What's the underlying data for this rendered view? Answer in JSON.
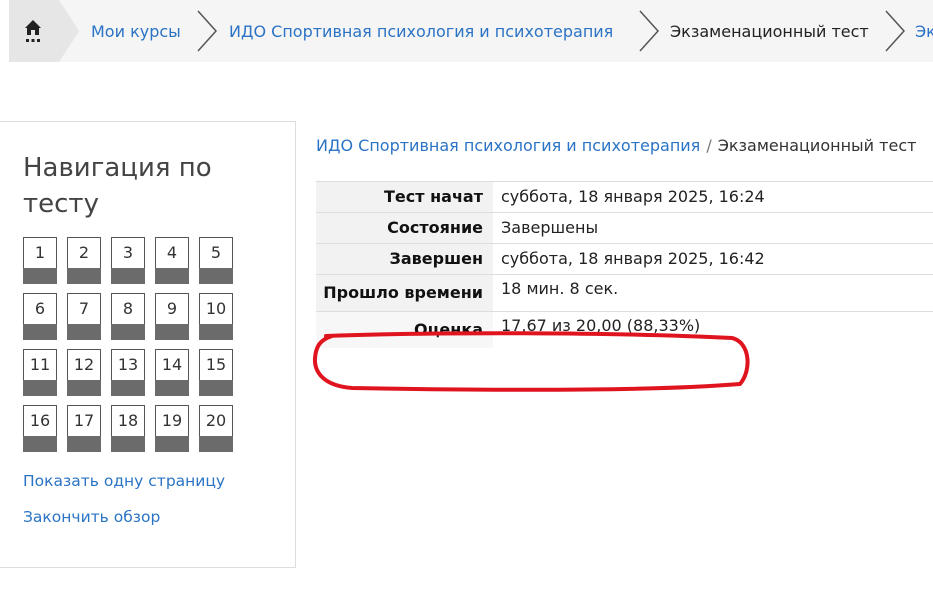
{
  "breadcrumb": {
    "items": [
      {
        "label": "Мои курсы",
        "type": "link"
      },
      {
        "label": "ИДО Спортивная психология и психотерапия",
        "type": "link"
      },
      {
        "label": "Экзаменационный тест",
        "type": "current"
      },
      {
        "label": "Эк",
        "type": "link"
      }
    ]
  },
  "nav": {
    "title": "Навигация по тесту",
    "questions": [
      "1",
      "2",
      "3",
      "4",
      "5",
      "6",
      "7",
      "8",
      "9",
      "10",
      "11",
      "12",
      "13",
      "14",
      "15",
      "16",
      "17",
      "18",
      "19",
      "20"
    ],
    "show_one_page": "Показать одну страницу",
    "finish_review": "Закончить обзор"
  },
  "header": {
    "course": "ИДО Спортивная психология и психотерапия",
    "separator": "/",
    "test": "Экзаменационный тест"
  },
  "summary": {
    "rows": [
      {
        "label": "Тест начат",
        "value": "суббота, 18 января 2025, 16:24"
      },
      {
        "label": "Состояние",
        "value": "Завершены"
      },
      {
        "label": "Завершен",
        "value": "суббота, 18 января 2025, 16:42"
      },
      {
        "label": "Прошло времени",
        "value": "18 мин. 8 сек."
      },
      {
        "label": "Оценка",
        "value": "17,67 из 20,00 (88,33%)"
      }
    ]
  },
  "colors": {
    "link": "#2a73c5",
    "highlight": "#e0141e"
  }
}
